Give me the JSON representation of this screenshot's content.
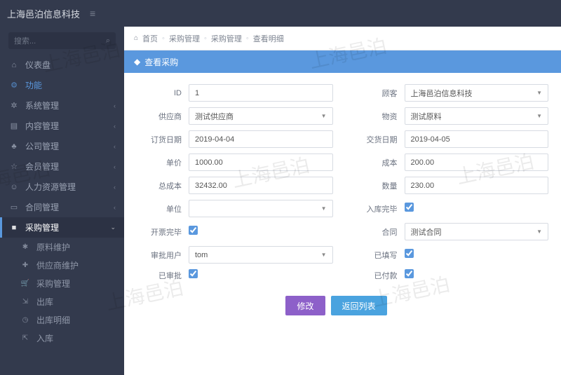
{
  "watermark": "上海邑泊",
  "header": {
    "brand": "上海邑泊信息科技",
    "burger": "≡"
  },
  "search": {
    "placeholder": "搜索...",
    "icon": "⌕"
  },
  "sidebar": {
    "items": [
      {
        "icon": "⌂",
        "label": "仪表盘",
        "chev": ""
      },
      {
        "icon": "⚙",
        "label": "功能",
        "chev": "",
        "func": true
      },
      {
        "icon": "✲",
        "label": "系统管理",
        "chev": "‹"
      },
      {
        "icon": "▤",
        "label": "内容管理",
        "chev": "‹"
      },
      {
        "icon": "♣",
        "label": "公司管理",
        "chev": "‹"
      },
      {
        "icon": "☆",
        "label": "会员管理",
        "chev": "‹"
      },
      {
        "icon": "☺",
        "label": "人力资源管理",
        "chev": "‹"
      },
      {
        "icon": "▭",
        "label": "合同管理",
        "chev": "‹"
      },
      {
        "icon": "■",
        "label": "采购管理",
        "chev": "⌄",
        "active": true
      }
    ],
    "subs": [
      {
        "icon": "✱",
        "label": "原料维护"
      },
      {
        "icon": "✚",
        "label": "供应商维护"
      },
      {
        "icon": "🛒",
        "label": "采购管理"
      },
      {
        "icon": "⇲",
        "label": "出库"
      },
      {
        "icon": "◷",
        "label": "出库明细"
      },
      {
        "icon": "⇱",
        "label": "入库"
      }
    ]
  },
  "crumb": {
    "home_icon": "⌂",
    "home": "首页",
    "l1": "采购管理",
    "l2": "采购管理",
    "l3": "查看明细",
    "sep": "◦"
  },
  "panel": {
    "icon": "◆",
    "title": "查看采购"
  },
  "fields": {
    "left": [
      {
        "label": "ID",
        "value": "1",
        "type": "text"
      },
      {
        "label": "供应商",
        "value": "测试供应商",
        "type": "select"
      },
      {
        "label": "订货日期",
        "value": "2019-04-04",
        "type": "text"
      },
      {
        "label": "单价",
        "value": "1000.00",
        "type": "text"
      },
      {
        "label": "总成本",
        "value": "32432.00",
        "type": "text"
      },
      {
        "label": "单位",
        "value": "",
        "type": "select"
      },
      {
        "label": "开票完毕",
        "value": true,
        "type": "check"
      },
      {
        "label": "审批用户",
        "value": "tom",
        "type": "select"
      },
      {
        "label": "已审批",
        "value": true,
        "type": "check"
      }
    ],
    "right": [
      {
        "label": "顾客",
        "value": "上海邑泊信息科技",
        "type": "select"
      },
      {
        "label": "物资",
        "value": "测试原料",
        "type": "select"
      },
      {
        "label": "交货日期",
        "value": "2019-04-05",
        "type": "text"
      },
      {
        "label": "成本",
        "value": "200.00",
        "type": "text"
      },
      {
        "label": "数量",
        "value": "230.00",
        "type": "text"
      },
      {
        "label": "入库完毕",
        "value": true,
        "type": "check"
      },
      {
        "label": "合同",
        "value": "测试合同",
        "type": "select"
      },
      {
        "label": "已填写",
        "value": true,
        "type": "check"
      },
      {
        "label": "已付款",
        "value": true,
        "type": "check"
      }
    ]
  },
  "buttons": {
    "modify": "修改",
    "back": "返回列表"
  }
}
